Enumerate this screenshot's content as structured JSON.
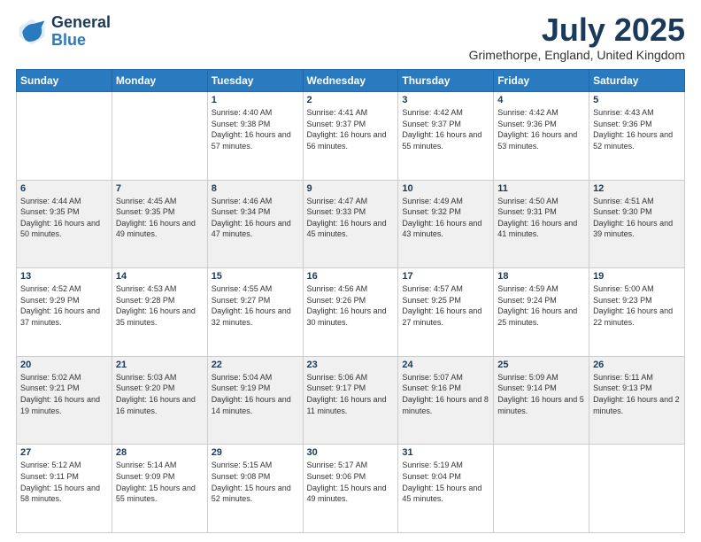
{
  "header": {
    "logo_line1": "General",
    "logo_line2": "Blue",
    "month": "July 2025",
    "location": "Grimethorpe, England, United Kingdom"
  },
  "days_of_week": [
    "Sunday",
    "Monday",
    "Tuesday",
    "Wednesday",
    "Thursday",
    "Friday",
    "Saturday"
  ],
  "weeks": [
    [
      {
        "day": "",
        "sunrise": "",
        "sunset": "",
        "daylight": ""
      },
      {
        "day": "",
        "sunrise": "",
        "sunset": "",
        "daylight": ""
      },
      {
        "day": "1",
        "sunrise": "Sunrise: 4:40 AM",
        "sunset": "Sunset: 9:38 PM",
        "daylight": "Daylight: 16 hours and 57 minutes."
      },
      {
        "day": "2",
        "sunrise": "Sunrise: 4:41 AM",
        "sunset": "Sunset: 9:37 PM",
        "daylight": "Daylight: 16 hours and 56 minutes."
      },
      {
        "day": "3",
        "sunrise": "Sunrise: 4:42 AM",
        "sunset": "Sunset: 9:37 PM",
        "daylight": "Daylight: 16 hours and 55 minutes."
      },
      {
        "day": "4",
        "sunrise": "Sunrise: 4:42 AM",
        "sunset": "Sunset: 9:36 PM",
        "daylight": "Daylight: 16 hours and 53 minutes."
      },
      {
        "day": "5",
        "sunrise": "Sunrise: 4:43 AM",
        "sunset": "Sunset: 9:36 PM",
        "daylight": "Daylight: 16 hours and 52 minutes."
      }
    ],
    [
      {
        "day": "6",
        "sunrise": "Sunrise: 4:44 AM",
        "sunset": "Sunset: 9:35 PM",
        "daylight": "Daylight: 16 hours and 50 minutes."
      },
      {
        "day": "7",
        "sunrise": "Sunrise: 4:45 AM",
        "sunset": "Sunset: 9:35 PM",
        "daylight": "Daylight: 16 hours and 49 minutes."
      },
      {
        "day": "8",
        "sunrise": "Sunrise: 4:46 AM",
        "sunset": "Sunset: 9:34 PM",
        "daylight": "Daylight: 16 hours and 47 minutes."
      },
      {
        "day": "9",
        "sunrise": "Sunrise: 4:47 AM",
        "sunset": "Sunset: 9:33 PM",
        "daylight": "Daylight: 16 hours and 45 minutes."
      },
      {
        "day": "10",
        "sunrise": "Sunrise: 4:49 AM",
        "sunset": "Sunset: 9:32 PM",
        "daylight": "Daylight: 16 hours and 43 minutes."
      },
      {
        "day": "11",
        "sunrise": "Sunrise: 4:50 AM",
        "sunset": "Sunset: 9:31 PM",
        "daylight": "Daylight: 16 hours and 41 minutes."
      },
      {
        "day": "12",
        "sunrise": "Sunrise: 4:51 AM",
        "sunset": "Sunset: 9:30 PM",
        "daylight": "Daylight: 16 hours and 39 minutes."
      }
    ],
    [
      {
        "day": "13",
        "sunrise": "Sunrise: 4:52 AM",
        "sunset": "Sunset: 9:29 PM",
        "daylight": "Daylight: 16 hours and 37 minutes."
      },
      {
        "day": "14",
        "sunrise": "Sunrise: 4:53 AM",
        "sunset": "Sunset: 9:28 PM",
        "daylight": "Daylight: 16 hours and 35 minutes."
      },
      {
        "day": "15",
        "sunrise": "Sunrise: 4:55 AM",
        "sunset": "Sunset: 9:27 PM",
        "daylight": "Daylight: 16 hours and 32 minutes."
      },
      {
        "day": "16",
        "sunrise": "Sunrise: 4:56 AM",
        "sunset": "Sunset: 9:26 PM",
        "daylight": "Daylight: 16 hours and 30 minutes."
      },
      {
        "day": "17",
        "sunrise": "Sunrise: 4:57 AM",
        "sunset": "Sunset: 9:25 PM",
        "daylight": "Daylight: 16 hours and 27 minutes."
      },
      {
        "day": "18",
        "sunrise": "Sunrise: 4:59 AM",
        "sunset": "Sunset: 9:24 PM",
        "daylight": "Daylight: 16 hours and 25 minutes."
      },
      {
        "day": "19",
        "sunrise": "Sunrise: 5:00 AM",
        "sunset": "Sunset: 9:23 PM",
        "daylight": "Daylight: 16 hours and 22 minutes."
      }
    ],
    [
      {
        "day": "20",
        "sunrise": "Sunrise: 5:02 AM",
        "sunset": "Sunset: 9:21 PM",
        "daylight": "Daylight: 16 hours and 19 minutes."
      },
      {
        "day": "21",
        "sunrise": "Sunrise: 5:03 AM",
        "sunset": "Sunset: 9:20 PM",
        "daylight": "Daylight: 16 hours and 16 minutes."
      },
      {
        "day": "22",
        "sunrise": "Sunrise: 5:04 AM",
        "sunset": "Sunset: 9:19 PM",
        "daylight": "Daylight: 16 hours and 14 minutes."
      },
      {
        "day": "23",
        "sunrise": "Sunrise: 5:06 AM",
        "sunset": "Sunset: 9:17 PM",
        "daylight": "Daylight: 16 hours and 11 minutes."
      },
      {
        "day": "24",
        "sunrise": "Sunrise: 5:07 AM",
        "sunset": "Sunset: 9:16 PM",
        "daylight": "Daylight: 16 hours and 8 minutes."
      },
      {
        "day": "25",
        "sunrise": "Sunrise: 5:09 AM",
        "sunset": "Sunset: 9:14 PM",
        "daylight": "Daylight: 16 hours and 5 minutes."
      },
      {
        "day": "26",
        "sunrise": "Sunrise: 5:11 AM",
        "sunset": "Sunset: 9:13 PM",
        "daylight": "Daylight: 16 hours and 2 minutes."
      }
    ],
    [
      {
        "day": "27",
        "sunrise": "Sunrise: 5:12 AM",
        "sunset": "Sunset: 9:11 PM",
        "daylight": "Daylight: 15 hours and 58 minutes."
      },
      {
        "day": "28",
        "sunrise": "Sunrise: 5:14 AM",
        "sunset": "Sunset: 9:09 PM",
        "daylight": "Daylight: 15 hours and 55 minutes."
      },
      {
        "day": "29",
        "sunrise": "Sunrise: 5:15 AM",
        "sunset": "Sunset: 9:08 PM",
        "daylight": "Daylight: 15 hours and 52 minutes."
      },
      {
        "day": "30",
        "sunrise": "Sunrise: 5:17 AM",
        "sunset": "Sunset: 9:06 PM",
        "daylight": "Daylight: 15 hours and 49 minutes."
      },
      {
        "day": "31",
        "sunrise": "Sunrise: 5:19 AM",
        "sunset": "Sunset: 9:04 PM",
        "daylight": "Daylight: 15 hours and 45 minutes."
      },
      {
        "day": "",
        "sunrise": "",
        "sunset": "",
        "daylight": ""
      },
      {
        "day": "",
        "sunrise": "",
        "sunset": "",
        "daylight": ""
      }
    ]
  ]
}
